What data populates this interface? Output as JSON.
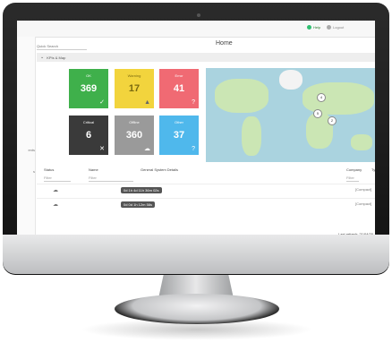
{
  "topbar": {
    "help_label": "Help",
    "logout_label": "Logout"
  },
  "sidebar": {
    "items": [
      {
        "label": "ents"
      },
      {
        "label": "s"
      }
    ]
  },
  "search": {
    "placeholder": "Quick Search"
  },
  "page": {
    "title": "Home"
  },
  "section": {
    "label": "KPIs & Map"
  },
  "tiles": [
    {
      "label": "OK",
      "value": "369",
      "color": "#3fb04b",
      "icon": "check-icon"
    },
    {
      "label": "Warning",
      "value": "17",
      "color": "#f2d43d",
      "icon": "warning-icon"
    },
    {
      "label": "Error",
      "value": "41",
      "color": "#f06a73",
      "icon": "question-icon"
    },
    {
      "label": "Critical",
      "value": "6",
      "color": "#3a3a3a",
      "icon": "close-icon"
    },
    {
      "label": "Offline",
      "value": "360",
      "color": "#9a9a9a",
      "icon": "cloud-off-icon"
    },
    {
      "label": "Other",
      "value": "37",
      "color": "#4fb8ec",
      "icon": "question-icon"
    }
  ],
  "map": {
    "markers": [
      "4",
      "5",
      "2"
    ]
  },
  "table": {
    "headers": {
      "status": "Status",
      "name": "Name",
      "general": "General System Details",
      "company": "Company",
      "type": "Type"
    },
    "filter_placeholder": "Filter",
    "rows": [
      {
        "details": "0d 1h 4d 11h 36m 02s",
        "company": "[Compact]"
      },
      {
        "details": "0d 0d 1h 12m 58s",
        "company": "[Compact]"
      }
    ]
  },
  "footer": {
    "last_refresh": "Last refresh: 21/04/20"
  }
}
